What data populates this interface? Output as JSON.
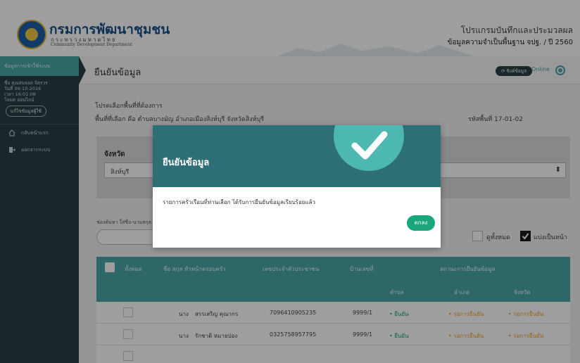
{
  "header": {
    "org_name": "กรมการพัฒนาชุมชน",
    "org_sub_th": "กระทรวงมหาดไทย",
    "org_sub_en": "Community Development Department",
    "program_title": "โปรแกรมบันทึกและประมวลผล",
    "program_subtitle": "ข้อมูลความจำเป็นพื้นฐาน จปฐ. / ปี 2560"
  },
  "sidebar": {
    "section_title": "ข้อมูลการเข้าใช้ระบบ",
    "user_lines": [
      "ชื่อ คุณสมจอต จิตรวร",
      "วันที่ 09-10-2016",
      "เวลา 16:01:08",
      "โหมด ออนไลน์"
    ],
    "user_button": "แก้ไขข้อมูลผู้ใช้",
    "items": [
      {
        "label": "กลับหน้าแรก",
        "icon": "home-icon"
      },
      {
        "label": "ออกจากระบบ",
        "icon": "logout-icon"
      }
    ]
  },
  "titlebar": {
    "page_title": "ยืนยันข้อมูล",
    "sync_label": "⟳ ซิงค์ข้อมูล",
    "status_label": "Online"
  },
  "content": {
    "prompt": "โปรดเลือกพื้นที่ที่ต้องการ",
    "selected_area": "พื้นที่ที่เลือก คือ ตำบลบางมัญ อำเภอเมืองสิงห์บุรี จังหวัดสิงห์บุรี",
    "area_code": "รหัสพื้นที่ 17-01-02",
    "province_label": "จังหวัด",
    "province_value": "สิงห์บุรี",
    "search_label": "ช่องค้นหา ใส่ชื่อ-นามสกุล",
    "show_all_label": "ดูทั้งหมด",
    "paginate_label": "แบ่งเป็นหน้า"
  },
  "table": {
    "headers": {
      "all": "ทั้งหมด",
      "name": "ชื่อ สกุล หัวหน้าครอบครัว",
      "id": "เลขประจำตัวประชาชน",
      "house": "บ้านเลขที่",
      "status": "สถานะการยืนยันข้อมูล",
      "tambon": "ตำบล",
      "amphoe": "อำเภอ",
      "province": "จังหวัด"
    },
    "rows": [
      {
        "title": "นาง",
        "name": "สรรเสริญ คุณากร",
        "id": "7096410905235",
        "house": "9999/1",
        "tambon": "ยืนยัน",
        "amphoe": "รอการยืนยัน",
        "province": "รอการยืนยัน"
      },
      {
        "title": "นาง",
        "name": "รักชาติ หมายปอง",
        "id": "0325758957795",
        "house": "9999/1",
        "tambon": "ยืนยัน",
        "amphoe": "รอการยืนยัน",
        "province": "รอการยืนยัน"
      }
    ]
  },
  "modal": {
    "title": "ยืนยันข้อมูล",
    "message": "รายการครัวเรือนที่ท่านเลือก ได้รับการยืนยันข้อมูลเรียบร้อยแล้ว",
    "ok_label": "ตกลง"
  },
  "colors": {
    "teal": "#4aa6a9",
    "dark_sidebar": "#2a3f44",
    "modal_header": "#2e6f75",
    "ok_green": "#1aa57c"
  }
}
